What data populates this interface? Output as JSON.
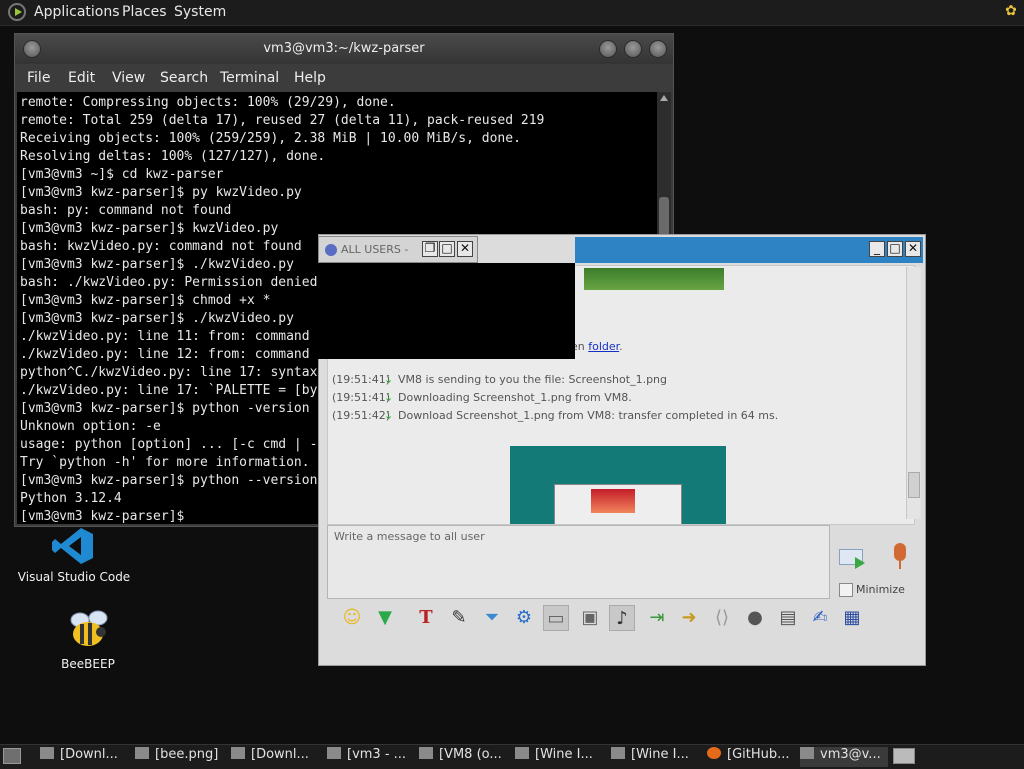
{
  "top_panel": {
    "menus": [
      "Applications",
      "Places",
      "System"
    ],
    "apps_icon": "gnome-foot-icon",
    "tray_icon": "beebeep-tray-icon"
  },
  "terminal": {
    "title": "vm3@vm3:~/kwz-parser",
    "menu": [
      "File",
      "Edit",
      "View",
      "Search",
      "Terminal",
      "Help"
    ],
    "lines": [
      "remote: Compressing objects: 100% (29/29), done.",
      "remote: Total 259 (delta 17), reused 27 (delta 11), pack-reused 219",
      "Receiving objects: 100% (259/259), 2.38 MiB | 10.00 MiB/s, done.",
      "Resolving deltas: 100% (127/127), done.",
      "[vm3@vm3 ~]$ cd kwz-parser",
      "[vm3@vm3 kwz-parser]$ py kwzVideo.py",
      "bash: py: command not found",
      "[vm3@vm3 kwz-parser]$ kwzVideo.py",
      "bash: kwzVideo.py: command not found",
      "[vm3@vm3 kwz-parser]$ ./kwzVideo.py",
      "bash: ./kwzVideo.py: Permission denied",
      "[vm3@vm3 kwz-parser]$ chmod +x *",
      "[vm3@vm3 kwz-parser]$ ./kwzVideo.py",
      "./kwzVideo.py: line 11: from: command not found",
      "./kwzVideo.py: line 12: from: command not found",
      "python^C./kwzVideo.py: line 17: syntax error near unexpected token `('",
      "./kwzVideo.py: line 17: `PALETTE = [by",
      "[vm3@vm3 kwz-parser]$ python -version",
      "Unknown option: -e",
      "usage: python [option] ... [-c cmd | -m mod | file | -] [arg] ...",
      "Try `python -h' for more information.",
      "[vm3@vm3 kwz-parser]$ python --version",
      "Python 3.12.4",
      "[vm3@vm3 kwz-parser]$ "
    ]
  },
  "allusers_mini": {
    "title": "ALL USERS -",
    "buttons": [
      "restore-icon",
      "maximize-icon",
      "close-icon"
    ]
  },
  "chat": {
    "folder_text": "pen ",
    "folder_link": "folder",
    "folder_after": ".",
    "messages": [
      {
        "time": "(19:51:41)",
        "text": "VM8 is sending to you the file: Screenshot_1.png"
      },
      {
        "time": "(19:51:41)",
        "text": "Downloading Screenshot_1.png from VM8."
      },
      {
        "time": "(19:51:42)",
        "text": "Download Screenshot_1.png from VM8: transfer completed in 64 ms."
      }
    ],
    "input_placeholder": "Write a message to all user",
    "minimize_label": "Minimize",
    "toolbar_icons": [
      "emoticon-icon",
      "arrow-down-icon",
      "font-icon",
      "color-icon",
      "filter-icon",
      "settings-icon",
      "hide-icon",
      "image-icon",
      "music-icon",
      "export-icon",
      "send-folder-icon",
      "code-icon",
      "record-icon",
      "screenshot-icon",
      "notes-icon",
      "save-icon"
    ]
  },
  "desktop": {
    "icons": [
      {
        "label": "Visual Studio Code",
        "icon": "vscode-icon"
      },
      {
        "label": "BeeBEEP",
        "icon": "bee-icon"
      }
    ]
  },
  "taskbar": {
    "items": [
      {
        "label": "[Downl...",
        "icon": "folder-icon"
      },
      {
        "label": "[bee.png]",
        "icon": "image-icon"
      },
      {
        "label": "[Downl...",
        "icon": "download-icon"
      },
      {
        "label": "[vm3 - ...",
        "icon": "beebeep-icon"
      },
      {
        "label": "[VM8 (o...",
        "icon": "vm-icon"
      },
      {
        "label": "[Wine I...",
        "icon": "wine-icon"
      },
      {
        "label": "[Wine I...",
        "icon": "wine-icon"
      },
      {
        "label": "[GitHub...",
        "icon": "firefox-icon"
      },
      {
        "label": "vm3@v...",
        "icon": "terminal-icon"
      }
    ]
  }
}
